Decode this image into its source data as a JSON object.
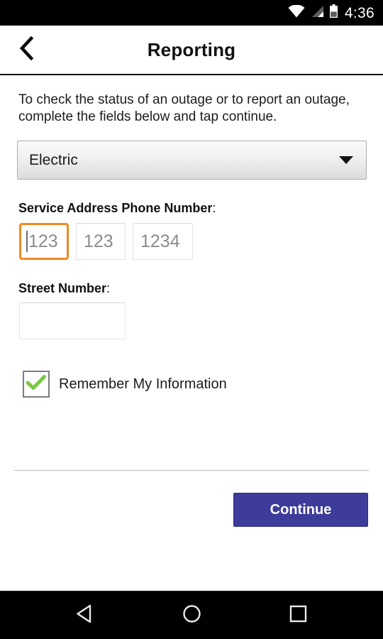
{
  "statusbar": {
    "time": "4:36",
    "icons": [
      "wifi-icon",
      "cellular-signal-icon",
      "battery-icon"
    ]
  },
  "appbar": {
    "title": "Reporting",
    "back_icon": "chevron-left-icon"
  },
  "main": {
    "intro_text": "To check the status of an outage or to report an outage, complete the fields below and tap continue.",
    "service_select": {
      "value": "Electric",
      "options": [
        "Electric"
      ],
      "caret_icon": "chevron-down-icon"
    },
    "phone_field": {
      "label": "Service Address Phone Number",
      "colon": ":",
      "parts": [
        {
          "placeholder": "123",
          "value": "",
          "focused": true
        },
        {
          "placeholder": "123",
          "value": "",
          "focused": false
        },
        {
          "placeholder": "1234",
          "value": "",
          "focused": false
        }
      ],
      "focus_color": "#ee8b23"
    },
    "street_field": {
      "label": "Street Number",
      "colon": ":",
      "value": "",
      "placeholder": ""
    },
    "remember": {
      "label": "Remember My Information",
      "checked": true,
      "check_color": "#7ac943"
    },
    "continue_button": {
      "label": "Continue",
      "color": "#3d3c9b"
    }
  },
  "navbar": {
    "back": "back-triangle-icon",
    "home": "home-circle-icon",
    "recents": "recents-square-icon"
  }
}
